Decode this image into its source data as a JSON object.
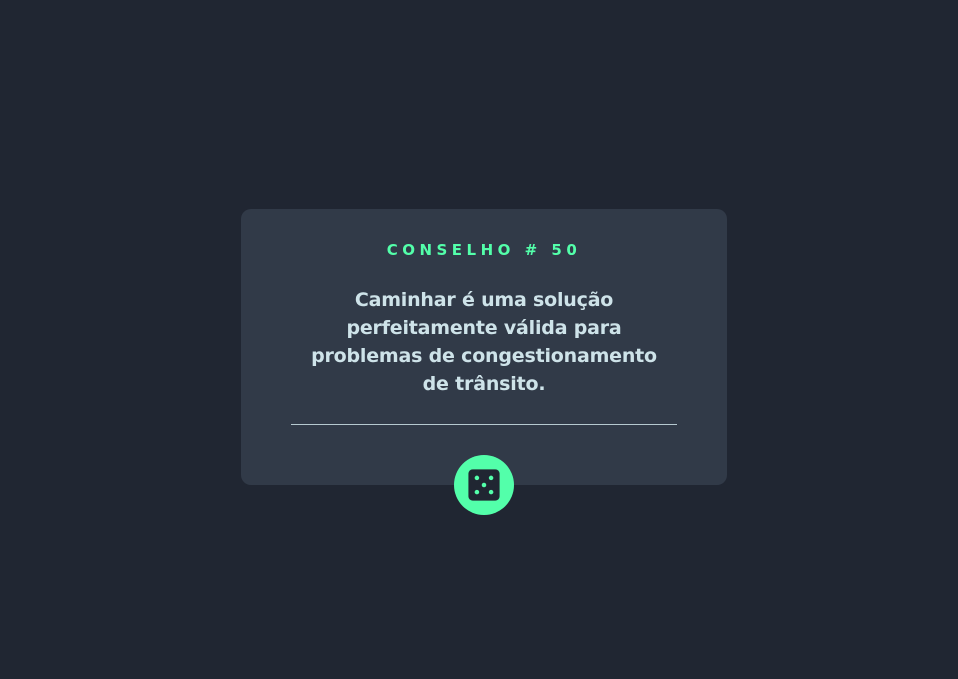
{
  "card": {
    "advice_id_label": "CONSELHO # 50",
    "advice_text": "Caminhar é uma solução perfeitamente válida para problemas de congestionamento de trânsito."
  },
  "dice_button": {
    "icon": "dice-icon"
  },
  "colors": {
    "background": "#202632",
    "card": "#313a48",
    "accent": "#53ffaa",
    "text": "#cee3e9"
  }
}
